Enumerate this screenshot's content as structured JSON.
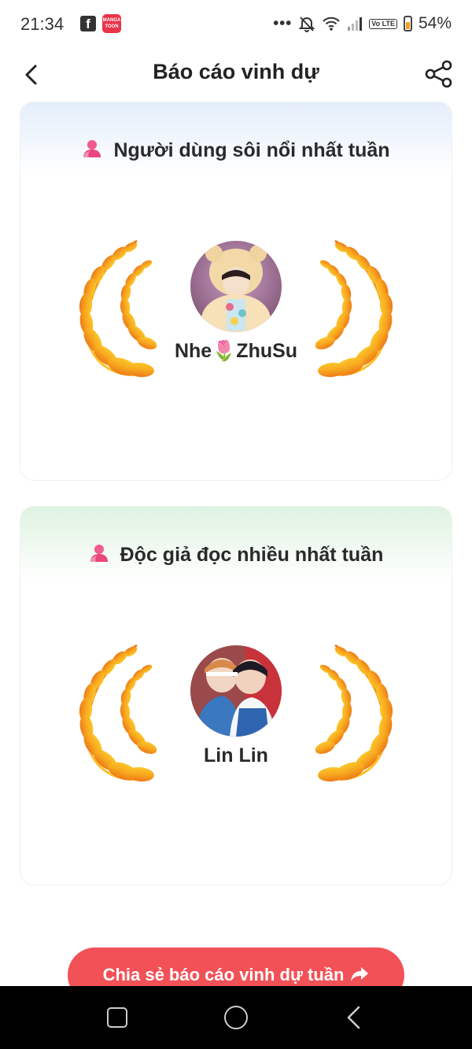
{
  "status_bar": {
    "time": "21:34",
    "facebook_icon": "f",
    "app_icon_text": "MANGA TOON",
    "lte_text": "Vo LTE",
    "battery": "54%"
  },
  "header": {
    "title": "Báo cáo vinh dự"
  },
  "cards": [
    {
      "heading": "Người dùng sôi nổi nhất tuần",
      "user_name": "Nhe🌷ZhuSu",
      "header_gradient": "#e4eefb"
    },
    {
      "heading": "Độc giả đọc nhiều nhất tuần",
      "user_name": "Lin Lin",
      "header_gradient": "#dff3e1"
    }
  ],
  "share_button": {
    "label": "Chia sẻ báo cáo vinh dự tuần"
  },
  "colors": {
    "accent": "#f25157",
    "laurel_gold": "#f7b81e",
    "laurel_orange": "#f0801c",
    "user_icon_pink": "#e8467c"
  }
}
